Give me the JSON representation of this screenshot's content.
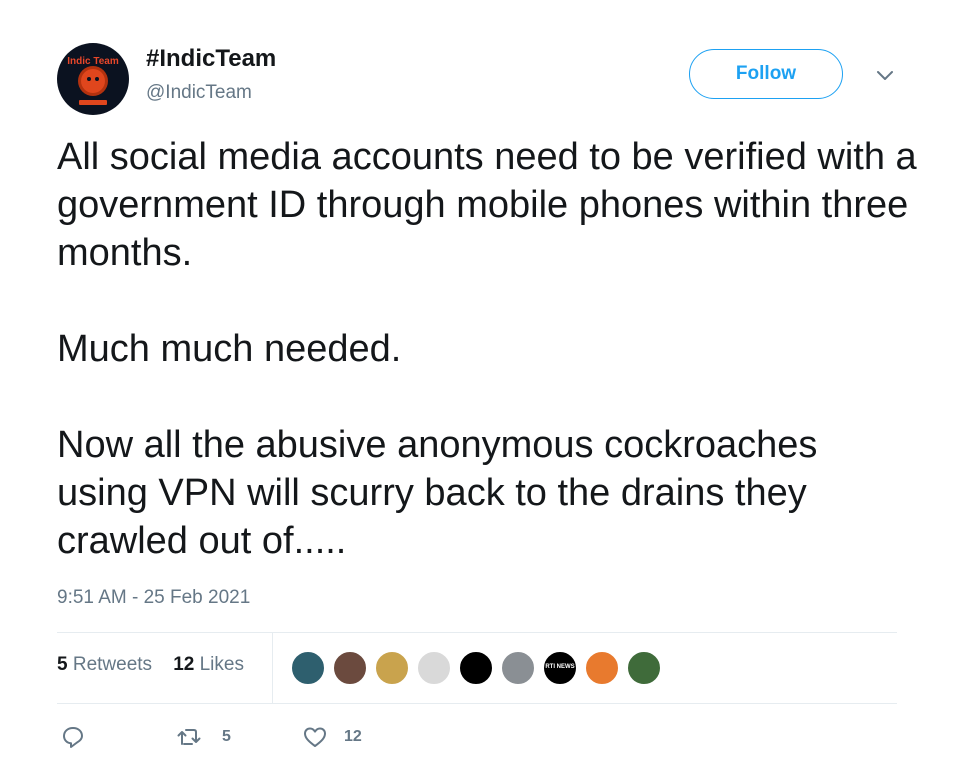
{
  "author": {
    "avatar_text": "Indic Team",
    "name": "#IndicTeam",
    "handle": "@IndicTeam"
  },
  "follow_label": "Follow",
  "tweet": {
    "paragraph_1": "All social media accounts need to be verified with a government ID through mobile phones within three months.",
    "paragraph_2": "Much much needed.",
    "paragraph_3": "Now all the abusive anonymous cockroaches using VPN will scurry back to the drains they crawled out of....."
  },
  "timestamp": "9:51 AM - 25 Feb 2021",
  "stats": {
    "retweets_count": "5",
    "retweets_label": "Retweets",
    "likes_count": "12",
    "likes_label": "Likes"
  },
  "likers": [
    {
      "name": "liker-avatar-1",
      "color": "#2e5f6e",
      "label": ""
    },
    {
      "name": "liker-avatar-2",
      "color": "#6b4a3e",
      "label": ""
    },
    {
      "name": "liker-avatar-3",
      "color": "#c9a34d",
      "label": ""
    },
    {
      "name": "liker-avatar-4",
      "color": "#d9d9d9",
      "label": ""
    },
    {
      "name": "liker-avatar-5",
      "color": "#000000",
      "label": ""
    },
    {
      "name": "liker-avatar-6",
      "color": "#8a8f94",
      "label": ""
    },
    {
      "name": "liker-avatar-7",
      "color": "#000000",
      "label": "RTI NEWS"
    },
    {
      "name": "liker-avatar-8",
      "color": "#e87a2e",
      "label": ""
    },
    {
      "name": "liker-avatar-9",
      "color": "#3f6b3a",
      "label": ""
    }
  ],
  "actions": {
    "reply_icon": "reply-icon",
    "retweet_icon": "retweet-icon",
    "retweet_count": "5",
    "like_icon": "heart-icon",
    "like_count": "12"
  },
  "colors": {
    "accent": "#1da1f2",
    "secondary_text": "#657786",
    "divider": "#e6ecf0"
  }
}
